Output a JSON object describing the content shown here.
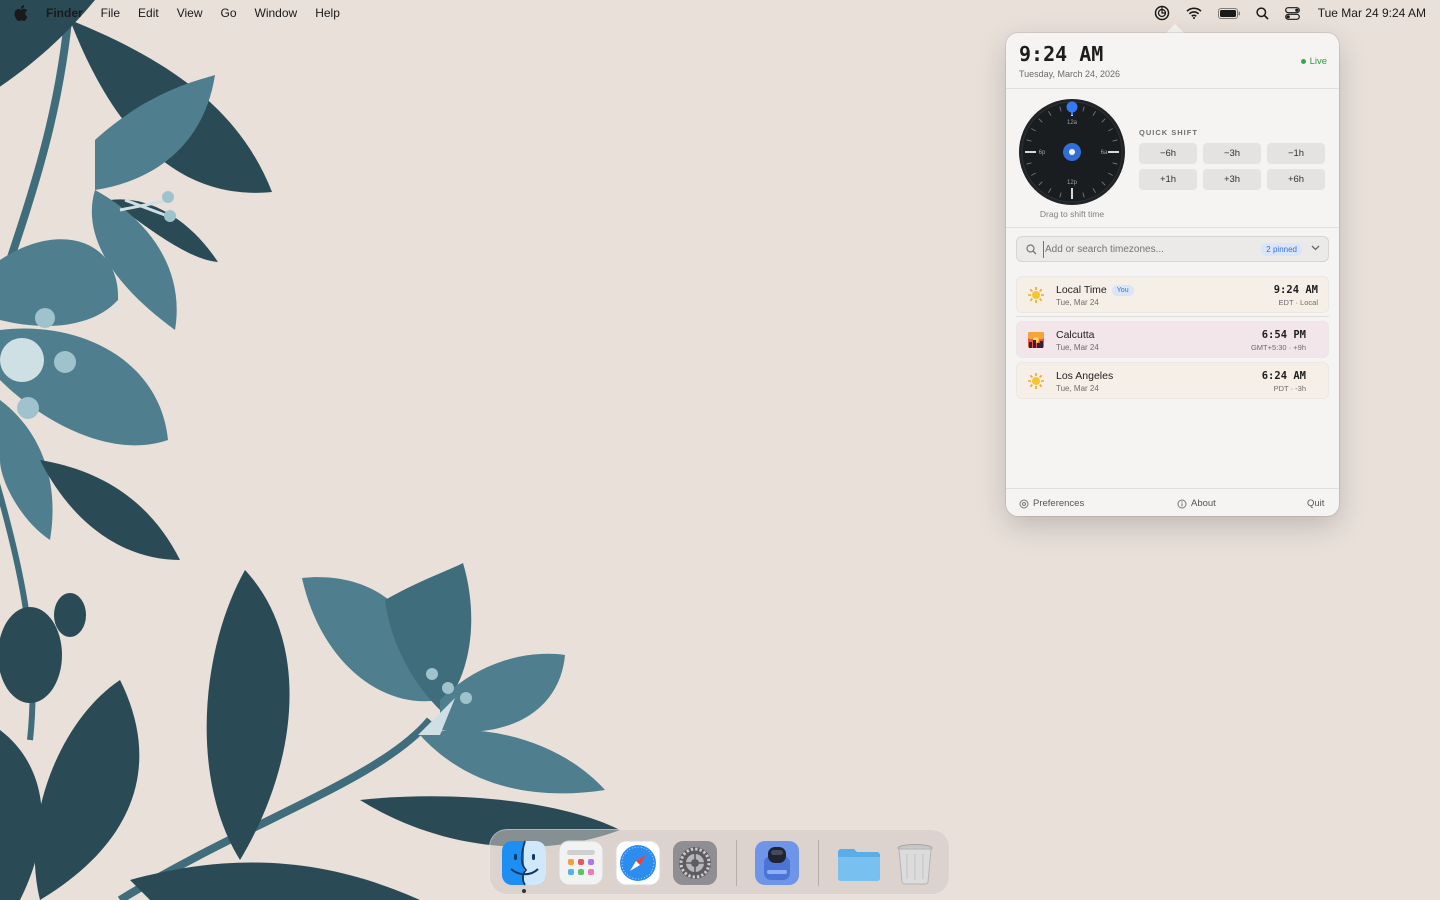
{
  "menubar": {
    "app_name": "Finder",
    "menus": [
      "File",
      "Edit",
      "View",
      "Go",
      "Window",
      "Help"
    ],
    "clock": "Tue Mar 24  9:24 AM",
    "status_icons": [
      "timezone-app-icon",
      "wifi-icon",
      "battery-icon",
      "spotlight-search-icon",
      "control-center-icon"
    ]
  },
  "popover": {
    "header": {
      "time": "9:24 AM",
      "date": "Tuesday, March 24, 2026",
      "live_label": "Live"
    },
    "dial": {
      "labels": {
        "top": "12a",
        "right": "6a",
        "bottom": "12p",
        "left": "6p"
      },
      "hint": "Drag to shift time"
    },
    "quick_shift": {
      "label": "QUICK SHIFT",
      "buttons": [
        "−6h",
        "−3h",
        "−1h",
        "+1h",
        "+3h",
        "+6h"
      ]
    },
    "search": {
      "placeholder": "Add or search timezones...",
      "pinned_badge": "2 pinned"
    },
    "timezones": [
      {
        "city": "Local Time",
        "badge": "You",
        "date": "Tue, Mar 24",
        "time": "9:24 AM",
        "zone": "EDT · Local",
        "icon": "sun-icon"
      },
      {
        "city": "Calcutta",
        "date": "Tue, Mar 24",
        "time": "6:54 PM",
        "zone": "GMT+5:30 · +9h",
        "icon": "sunset-icon"
      },
      {
        "city": "Los Angeles",
        "date": "Tue, Mar 24",
        "time": "6:24 AM",
        "zone": "PDT · -3h",
        "icon": "sun-icon"
      }
    ],
    "footer": {
      "preferences": "Preferences",
      "about": "About",
      "quit": "Quit"
    }
  },
  "dock": {
    "apps": [
      "Finder",
      "Launchpad",
      "Safari",
      "System Settings",
      "Timezone App",
      "Downloads Folder",
      "Trash"
    ]
  },
  "colors": {
    "accent": "#3478f6",
    "live_green": "#34a853",
    "wallpaper_bg": "#e9e0da",
    "leaf_dark": "#2a4a56",
    "leaf_light": "#4f7f8e"
  }
}
